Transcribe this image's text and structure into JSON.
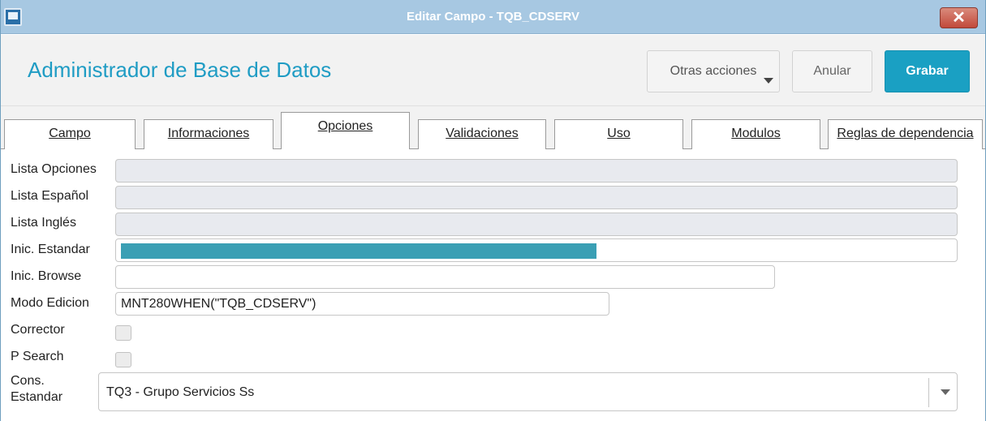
{
  "window": {
    "title": "Editar Campo - TQB_CDSERV",
    "close_glyph": "✕"
  },
  "header": {
    "app_title": "Administrador de Base de Datos",
    "buttons": {
      "otras": "Otras acciones",
      "anular": "Anular",
      "grabar": "Grabar"
    }
  },
  "tabs": [
    {
      "label": "Campo"
    },
    {
      "label": "Informaciones"
    },
    {
      "label": "Opciones",
      "active": true
    },
    {
      "label": "Validaciones"
    },
    {
      "label": "Uso"
    },
    {
      "label": "Modulos"
    },
    {
      "label": "Reglas de dependencia"
    }
  ],
  "form": {
    "lista_opciones": {
      "label": "Lista Opciones",
      "value": ""
    },
    "lista_espanol": {
      "label": "Lista Español",
      "value": ""
    },
    "lista_ingles": {
      "label": "Lista Inglés",
      "value": ""
    },
    "inic_estandar": {
      "label": "Inic. Estandar",
      "value": ""
    },
    "inic_browse": {
      "label": "Inic. Browse",
      "value": ""
    },
    "modo_edicion": {
      "label": "Modo Edicion",
      "value": "MNT280WHEN(\"TQB_CDSERV\")"
    },
    "corrector": {
      "label": "Corrector",
      "checked": false
    },
    "p_search": {
      "label": "P Search",
      "checked": false
    },
    "cons_estandar": {
      "label": "Cons. Estandar",
      "value": "TQ3 - Grupo Servicios Ss"
    }
  },
  "colors": {
    "accent": "#1aa0c3",
    "titlebar": "#a7c8e2",
    "selection": "#3a9fb4"
  },
  "icons": [
    "app-icon",
    "close-icon",
    "dropdown-caret-icon",
    "select-arrow-icon"
  ]
}
